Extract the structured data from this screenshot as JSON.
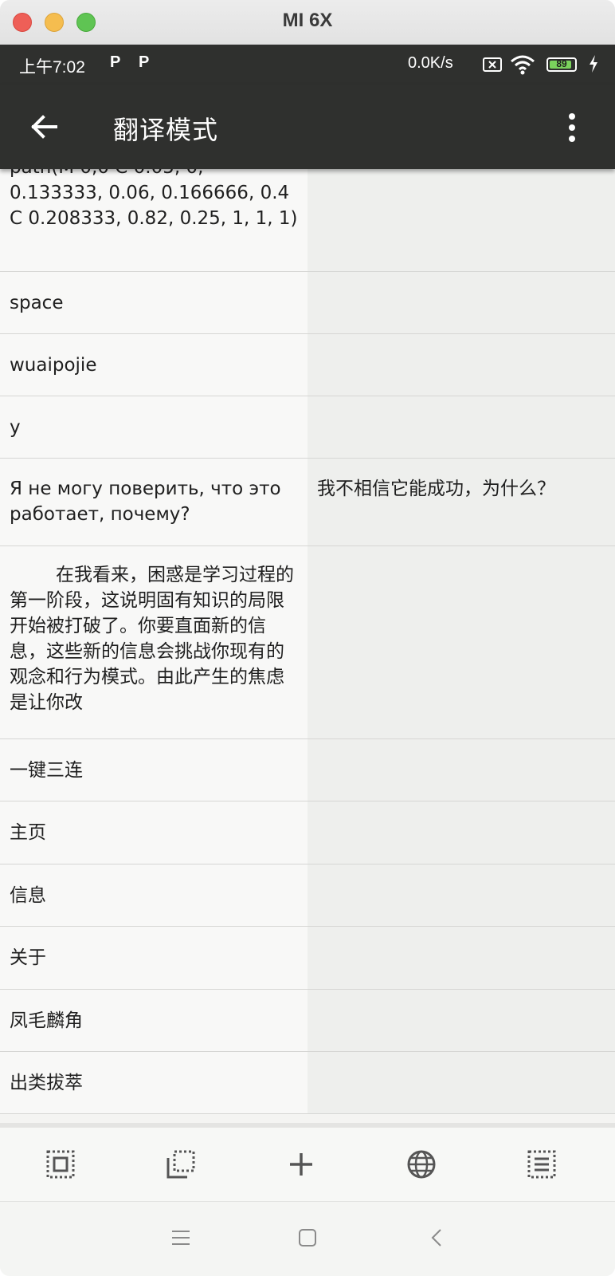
{
  "window": {
    "title": "MI 6X"
  },
  "status_bar": {
    "time": "上午7:02",
    "p_icon_1": "P",
    "p_icon_2": "P",
    "net_speed": "0.0K/s",
    "battery": "89",
    "battery_level": 0.89
  },
  "app_bar": {
    "title": "翻译模式"
  },
  "rows": [
    {
      "source": "path(M 0,0 C 0.05, 0, 0.133333, 0.06, 0.166666, 0.4 C 0.208333, 0.82, 0.25, 1, 1, 1)",
      "translation": ""
    },
    {
      "source": "space",
      "translation": ""
    },
    {
      "source": "wuaipojie",
      "translation": ""
    },
    {
      "source": "y",
      "translation": ""
    },
    {
      "source": "Я не могу поверить, что это работает, почему?",
      "translation": "我不相信它能成功，为什么？"
    },
    {
      "source": "在我看来，困惑是学习过程的第一阶段，这说明固有知识的局限开始被打破了。你要直面新的信息，这些新的信息会挑战你现有的观念和行为模式。由此产生的焦虑是让你改",
      "translation": ""
    },
    {
      "source": "一键三连",
      "translation": ""
    },
    {
      "source": "主页",
      "translation": ""
    },
    {
      "source": "信息",
      "translation": ""
    },
    {
      "source": "关于",
      "translation": ""
    },
    {
      "source": "凤毛麟角",
      "translation": ""
    },
    {
      "source": "出类拔萃",
      "translation": ""
    }
  ],
  "toolbar": {
    "icons": [
      "select-all-icon",
      "copy-icon",
      "add-icon",
      "globe-icon",
      "list-icon"
    ]
  },
  "nav_bar": {
    "icons": [
      "menu-icon",
      "home-icon",
      "back-icon"
    ]
  }
}
